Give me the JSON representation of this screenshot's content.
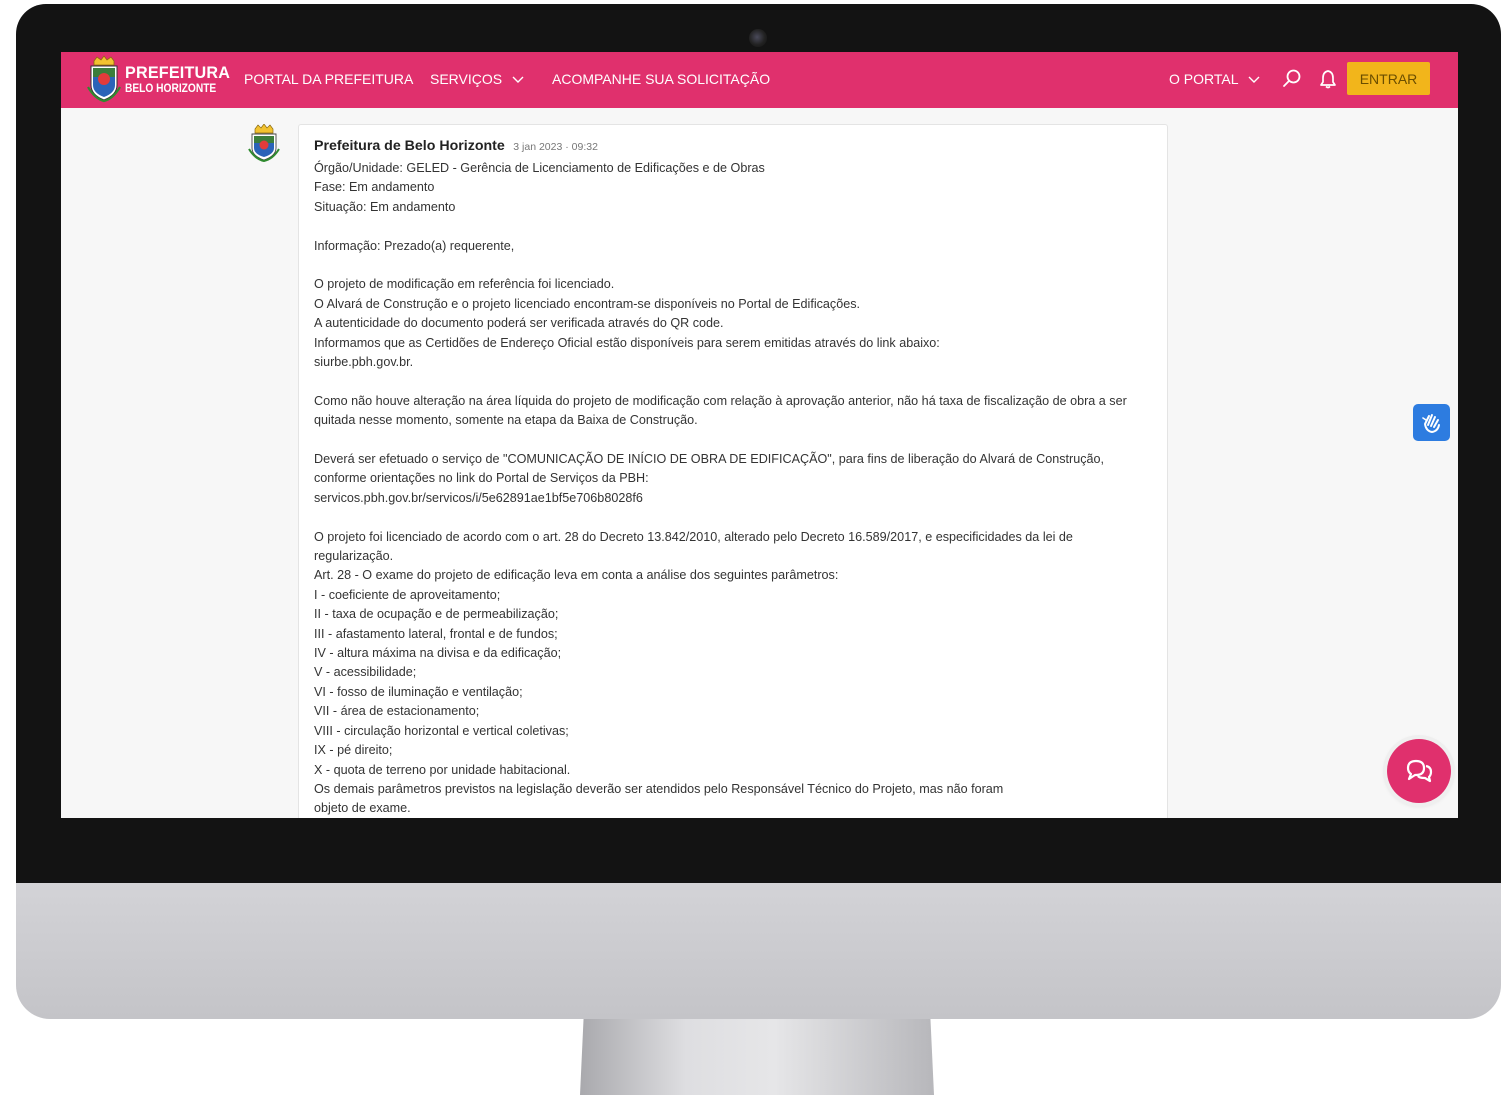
{
  "navbar": {
    "brand_line1": "PREFEITURA",
    "brand_line2": "BELO HORIZONTE",
    "portal_link": "PORTAL DA PREFEITURA",
    "services_link": "SERVIÇOS",
    "track_link": "ACOMPANHE SUA SOLICITAÇÃO",
    "o_portal_link": "O PORTAL",
    "login_label": "ENTRAR",
    "bg_color": "#e0306d",
    "login_color": "#f2b51b"
  },
  "icons": {
    "services_dropdown": "chevron-down-icon",
    "portal_dropdown": "chevron-down-icon",
    "search": "search-icon",
    "notifications": "bell-icon",
    "accessibility": "sign-language-icon",
    "chat": "chat-bubbles-icon"
  },
  "post": {
    "author": "Prefeitura de Belo Horizonte",
    "timestamp": "3 jan 2023 · 09:32",
    "lines": [
      "Órgão/Unidade: GELED - Gerência de Licenciamento de Edificações e de Obras",
      "Fase: Em andamento",
      "Situação: Em andamento",
      "",
      "Informação: Prezado(a) requerente,",
      "",
      "O projeto de modificação em referência foi licenciado.",
      "O Alvará de Construção e o projeto licenciado encontram-se disponíveis no Portal de Edificações.",
      "A autenticidade do documento poderá ser verificada através do QR code.",
      "Informamos que as Certidões de Endereço Oficial estão disponíveis para serem emitidas através do link abaixo:",
      "siurbe.pbh.gov.br.",
      "",
      "Como não houve alteração na área líquida do projeto de modificação com relação à aprovação anterior, não há taxa de fiscalização de obra a ser",
      "quitada nesse momento, somente na etapa da Baixa de Construção.",
      "",
      "Deverá ser efetuado o serviço de \"COMUNICAÇÃO DE INÍCIO DE OBRA DE EDIFICAÇÃO\", para fins de liberação do Alvará de Construção,",
      "conforme orientações no link do Portal de Serviços da PBH:",
      "servicos.pbh.gov.br/servicos/i/5e62891ae1bf5e706b8028f6",
      "",
      "O projeto foi licenciado de acordo com o art. 28 do Decreto 13.842/2010, alterado pelo Decreto 16.589/2017, e especificidades da lei de",
      "regularização.",
      "Art. 28 - O exame do projeto de edificação leva em conta a análise dos seguintes parâmetros:",
      "I - coeficiente de aproveitamento;",
      "II - taxa de ocupação e de permeabilização;",
      "III - afastamento lateral, frontal e de fundos;",
      "IV - altura máxima na divisa e da edificação;",
      "V - acessibilidade;",
      "VI - fosso de iluminação e ventilação;",
      "VII - área de estacionamento;",
      "VIII - circulação horizontal e vertical coletivas;",
      "IX - pé direito;",
      "X - quota de terreno por unidade habitacional.",
      "Os demais parâmetros previstos na legislação deverão ser atendidos pelo Responsável Técnico do Projeto, mas não foram",
      "objeto de exame."
    ]
  }
}
